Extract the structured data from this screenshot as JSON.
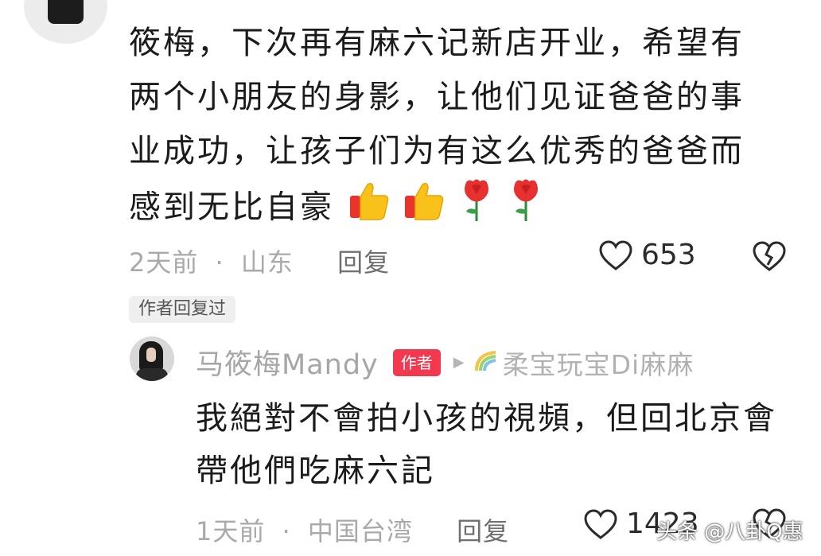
{
  "comment": {
    "text": "筱梅，下次再有麻六记新店开业，希望有两个小朋友的身影，让他们见证爸爸的事业成功，让孩子们为有这么优秀的爸爸而感到无比自豪",
    "emojis": [
      "thumbs-up-icon",
      "thumbs-up-icon",
      "rose-icon",
      "rose-icon"
    ],
    "time": "2天前",
    "separator": "·",
    "location": "山东",
    "reply_label": "回复",
    "likes": "653",
    "author_replied": "作者回复过"
  },
  "reply": {
    "name": "马筱梅Mandy",
    "badge": "作者",
    "reply_to": "柔宝玩宝Di麻麻",
    "text": "我絕對不會拍小孩的視頻，但回北京會帶他們吃麻六記",
    "time": "1天前",
    "separator": "·",
    "location": "中国台湾",
    "reply_label": "回复",
    "likes": "1423"
  },
  "watermark": "头条 @八卦Q惠",
  "colors": {
    "badge": "#f2394f",
    "meta": "#a9a9a9",
    "text": "#1b1b1b"
  }
}
